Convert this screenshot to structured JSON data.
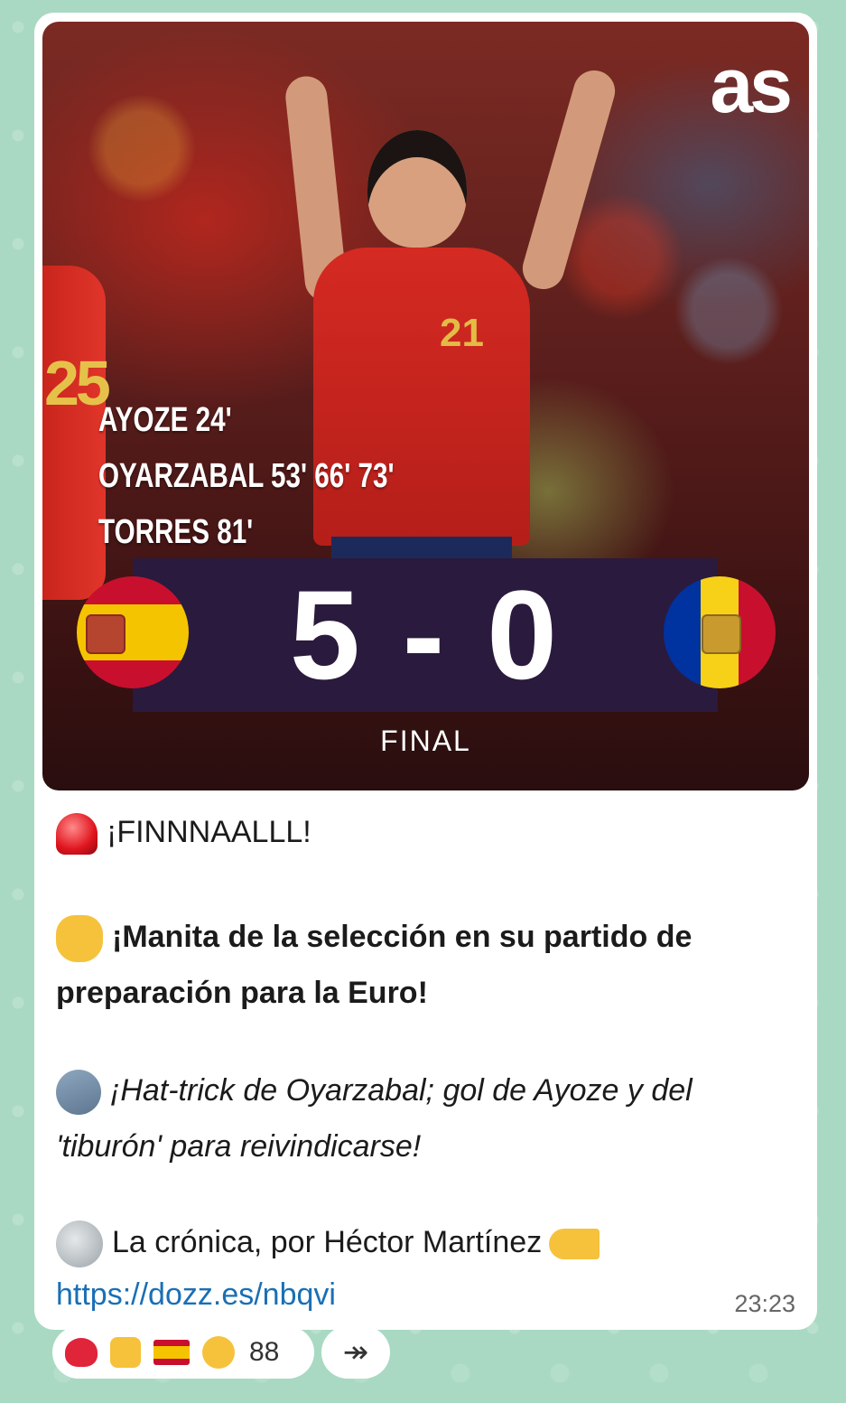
{
  "media": {
    "brand": "as",
    "scorers": [
      "AYOZE 24'",
      "OYARZABAL 53' 66' 73'",
      "TORRES 81'"
    ],
    "score": "5 - 0",
    "status": "FINAL",
    "player_number": "21",
    "player_number_left": "25",
    "home_team_flag": "spain-flag",
    "away_team_flag": "andorra-flag"
  },
  "message": {
    "line1": "¡FINNNAALLL!",
    "line2": "¡Manita de la selección en su partido de preparación para la Euro!",
    "line3": "¡Hat-trick de Oyarzabal; gol de Ayoze y del 'tiburón' para reivindicarse!",
    "line4": "La crónica, por Héctor Martínez",
    "link": "https://dozz.es/nbqvi",
    "time": "23:23"
  },
  "reactions": {
    "emojis": [
      "heart",
      "thumbs-up",
      "spain-flag",
      "joy"
    ],
    "count": "88"
  },
  "forward_icon": "↠",
  "colors": {
    "bubble": "#ffffff",
    "wallpaper": "#a9d9c3",
    "link": "#1a6fb5",
    "scorebar": "#2a1a3d"
  }
}
